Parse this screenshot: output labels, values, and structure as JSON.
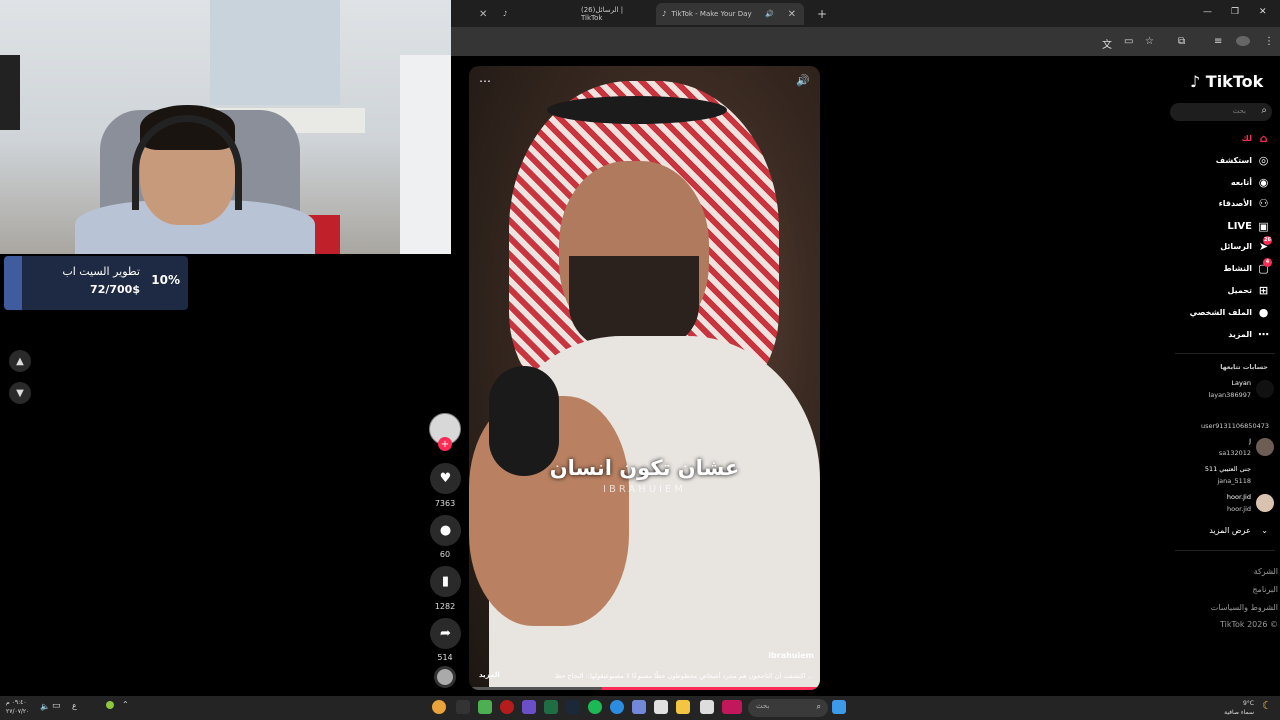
{
  "browser": {
    "tabs": [
      {
        "title": "(26)الرسائل | TikTok",
        "active": false
      },
      {
        "title": "TikTok - Make Your Day",
        "active": true
      }
    ],
    "new_tab_label": "+"
  },
  "stream_overlay": {
    "goal_title": "تطوير السيت اب",
    "goal_amount": "72/700$",
    "goal_percent": "10%"
  },
  "video": {
    "caption": "عشان تكون انسان",
    "watermark": "IBRAHUIEM",
    "username": "ibrahuiem",
    "description": "اكتشفت أن الناجحون هم مجرد أشخاص محظوظون حظًا مصنوعًا لا مصنوعيقولها:: النجاح حظ ...",
    "more_label": "المزيد",
    "progress": 0.62,
    "stats": {
      "likes": "7363",
      "comments": "60",
      "saves": "1282",
      "shares": "514"
    }
  },
  "sidebar": {
    "logo": "TikTok",
    "search_placeholder": "بحث",
    "nav": [
      {
        "label": "لك",
        "icon": "home-icon",
        "active": true
      },
      {
        "label": "استكشف",
        "icon": "compass-icon"
      },
      {
        "label": "أتابعه",
        "icon": "following-icon"
      },
      {
        "label": "الأصدقاء",
        "icon": "friends-icon"
      },
      {
        "label": "LIVE",
        "icon": "live-icon"
      },
      {
        "label": "الرسائل",
        "icon": "messages-icon",
        "badge": "26"
      },
      {
        "label": "النشاط",
        "icon": "activity-icon",
        "badge": "4"
      },
      {
        "label": "تحميل",
        "icon": "upload-icon"
      },
      {
        "label": "الملف الشخصي",
        "icon": "profile-icon"
      },
      {
        "label": "المزيد",
        "icon": "more-icon"
      }
    ],
    "following_title": "حسابات تتابعها",
    "accounts": [
      {
        "name": "Layan",
        "user": "layan386997"
      },
      {
        "name": "",
        "user": "user9131106850473"
      },
      {
        "name": "J",
        "user": "sa132012"
      },
      {
        "name": "جنى العتيبي 511",
        "user": "jana_5118"
      },
      {
        "name": "hoor.Jid",
        "user": "hoor.jid"
      }
    ],
    "see_more": "عرض المزيد",
    "footer": [
      "الشركة",
      "البرنامج",
      "الشروط والسياسات",
      "TikTok 2026 ©"
    ]
  },
  "taskbar": {
    "search_placeholder": "بحث",
    "time": "٠٩:٤٠ م",
    "date": "٢٧/٠٧/٢٠",
    "weather_temp": "9°C",
    "weather_desc": "سماء صافية"
  }
}
